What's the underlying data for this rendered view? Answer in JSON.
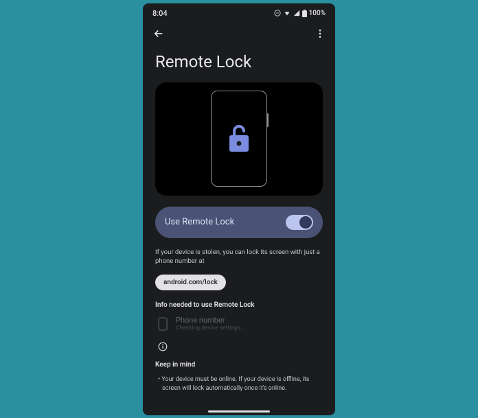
{
  "status": {
    "time": "8:04",
    "battery_text": "100%"
  },
  "page": {
    "title": "Remote Lock"
  },
  "toggle": {
    "label": "Use Remote Lock",
    "on": true
  },
  "description": "If your device is stolen, you can lock its screen with just a phone number at",
  "chip": {
    "label": "android.com/lock"
  },
  "info_section": {
    "title": "Info needed to use Remote Lock",
    "phone": {
      "label": "Phone number",
      "sub": "Checking device settings..."
    }
  },
  "keep_in_mind": {
    "title": "Keep in mind",
    "bullet1": "Your device must be online. If your device is offline, its screen will lock automatically once it's online."
  }
}
